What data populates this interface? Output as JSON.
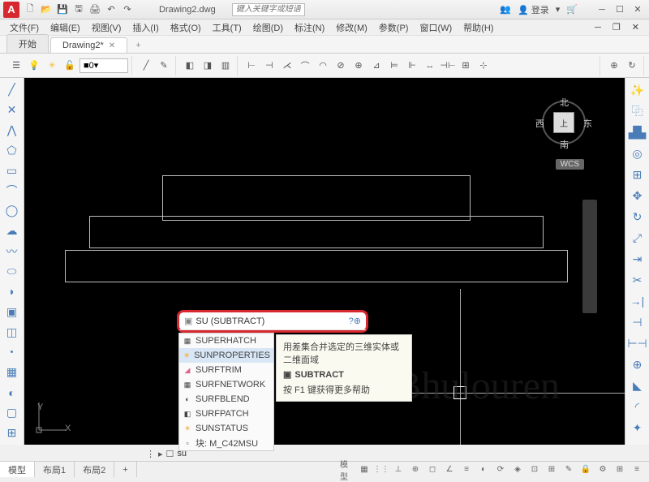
{
  "app": {
    "icon_letter": "A",
    "doc_title": "Drawing2.dwg",
    "search_placeholder": "键入关键字或短语",
    "login": "登录"
  },
  "menus": [
    "文件(F)",
    "编辑(E)",
    "视图(V)",
    "插入(I)",
    "格式(O)",
    "工具(T)",
    "绘图(D)",
    "标注(N)",
    "修改(M)",
    "参数(P)",
    "窗口(W)",
    "帮助(H)"
  ],
  "tabs": {
    "start": "开始",
    "current": "Drawing2*"
  },
  "layer": {
    "zero": "0"
  },
  "viewcube": {
    "top": "上",
    "n": "北",
    "s": "南",
    "e": "东",
    "w": "西",
    "wcs": "WCS"
  },
  "ucs": {
    "x": "X",
    "y": "Y"
  },
  "command": {
    "input": "SU (SUBTRACT)",
    "help_icon": "?",
    "search_icon": "⊕"
  },
  "suggestions": [
    {
      "label": "SUPERHATCH",
      "ic": "▦"
    },
    {
      "label": "SUNPROPERTIES",
      "ic": "☀",
      "hl": true
    },
    {
      "label": "SURFTRIM",
      "ic": "◢"
    },
    {
      "label": "SURFNETWORK",
      "ic": "▦"
    },
    {
      "label": "SURFBLEND",
      "ic": "◐"
    },
    {
      "label": "SURFPATCH",
      "ic": "◧"
    },
    {
      "label": "SUNSTATUS",
      "ic": "☀"
    },
    {
      "label": "块: M_C42MSU",
      "ic": "▫"
    }
  ],
  "tooltip": {
    "desc": "用差集合并选定的三维实体或二维面域",
    "title": "SUBTRACT",
    "help": "按 F1 键获得更多帮助"
  },
  "cmdline": {
    "prompt": "▸",
    "value": "su"
  },
  "layouts": [
    "模型",
    "布局1",
    "布局2",
    "+"
  ],
  "status_model": "模型",
  "watermark": "Bhulouren"
}
